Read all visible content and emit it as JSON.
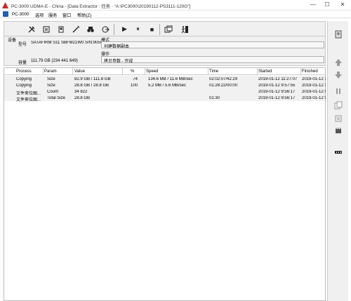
{
  "window": {
    "title": "PC-3000 UDMA-E - China - [Data Extractor : 任务 - \"A:\\PC3000\\20190112-PS3111-120G\"]",
    "min": "—",
    "max": "☐",
    "close": "✕"
  },
  "menu": [
    "PC-3000",
    "选项",
    "服务",
    "窗口",
    "帮助(Z)"
  ],
  "toolbar": {
    "play": "▶",
    "pause": "⏸",
    "stop": "■"
  },
  "info": {
    "device_label": "设备",
    "model_label": "型号",
    "model_value": "SATAFIRM   S11 SBFM21W0 S/N:9050",
    "capacity_label": "容量",
    "capacity_value": "111.79 GB (234 441 649)",
    "mode_label": "模式",
    "mode_value": "创建数据副本",
    "operation_label": "操作",
    "operation_value": "拷贝参数 - 完成"
  },
  "table": {
    "headers": [
      "Process",
      "Param",
      "Value",
      "%",
      "Speed",
      "Time",
      "Started",
      "Finished"
    ],
    "rows": [
      [
        "Copying",
        "Size",
        "82.9 GB / 111.8 GB",
        "74",
        "134.6 MB / 11.6 MB/sec",
        "02:02:07/42:29",
        "2019-01-12 11:27:07",
        "2019-01-12 1"
      ],
      [
        "Copying",
        "Size",
        "28.8 GB / 28.8 GB",
        "100",
        "5.2 MB / 5.6 MB/sec",
        "01:28:22/00:00",
        "2019-01-12 9:57:55",
        "2019-01-12 1"
      ],
      [
        "文件夹位图...",
        "Count",
        "34 822",
        "",
        "",
        "",
        "2019-01-12 9:56:17",
        "2019-01-12 9"
      ],
      [
        "文件夹位图...",
        "Total Size",
        "28.8 GB",
        "",
        "",
        "01:30",
        "2019-01-12 9:56:17",
        "2019-01-12 9"
      ]
    ]
  }
}
